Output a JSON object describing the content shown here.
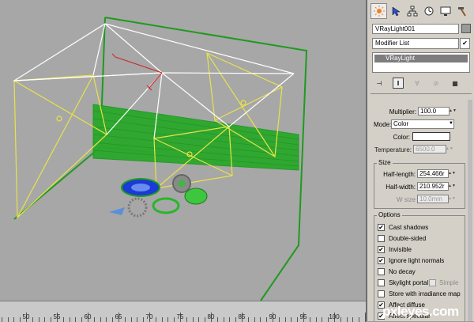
{
  "object_name": "VRayLight001",
  "modifier_list_label": "Modifier List",
  "modifier_stack": [
    "VRayLight"
  ],
  "command_tabs": [
    {
      "icon": "sun-icon"
    },
    {
      "icon": "pointer-icon"
    },
    {
      "icon": "hierarchy-icon"
    },
    {
      "icon": "motion-icon"
    },
    {
      "icon": "display-icon"
    },
    {
      "icon": "hammer-icon"
    }
  ],
  "intensity": {
    "multiplier_label": "Multiplier:",
    "multiplier_value": "100.0",
    "mode_label": "Mode:",
    "mode_value": "Color",
    "color_label": "Color:",
    "color_value": "#ffffff",
    "temperature_label": "Temperature:",
    "temperature_value": "6500.0"
  },
  "size": {
    "title": "Size",
    "half_length_label": "Half-length:",
    "half_length_value": "254.466r",
    "half_width_label": "Half-width:",
    "half_width_value": "210.952r",
    "w_size_label": "W size",
    "w_size_value": "10.0mm"
  },
  "options": {
    "title": "Options",
    "items": [
      {
        "label": "Cast shadows",
        "checked": true,
        "enabled": true
      },
      {
        "label": "Double-sided",
        "checked": false,
        "enabled": true
      },
      {
        "label": "Invisible",
        "checked": true,
        "enabled": true
      },
      {
        "label": "Ignore light normals",
        "checked": true,
        "enabled": true
      },
      {
        "label": "No decay",
        "checked": false,
        "enabled": true
      },
      {
        "label": "Skylight portal",
        "checked": false,
        "enabled": true
      },
      {
        "label": "Store with irradiance map",
        "checked": false,
        "enabled": true
      },
      {
        "label": "Affect diffuse",
        "checked": true,
        "enabled": true
      },
      {
        "label": "Affect specular",
        "checked": true,
        "enabled": true
      }
    ],
    "simple_label": "Simple"
  },
  "timeline": {
    "labels": [
      "50",
      "55",
      "60",
      "65",
      "70",
      "75",
      "80",
      "85",
      "90",
      "95",
      "100"
    ]
  },
  "watermark": "pxleyes.com",
  "colors": {
    "viewport_bg": "#a7a7a7",
    "light_yellow": "#e8e34a",
    "light_white": "#ffffff",
    "geometry_green": "#1f9a1f",
    "selection_blue": "#2a3fd0"
  }
}
